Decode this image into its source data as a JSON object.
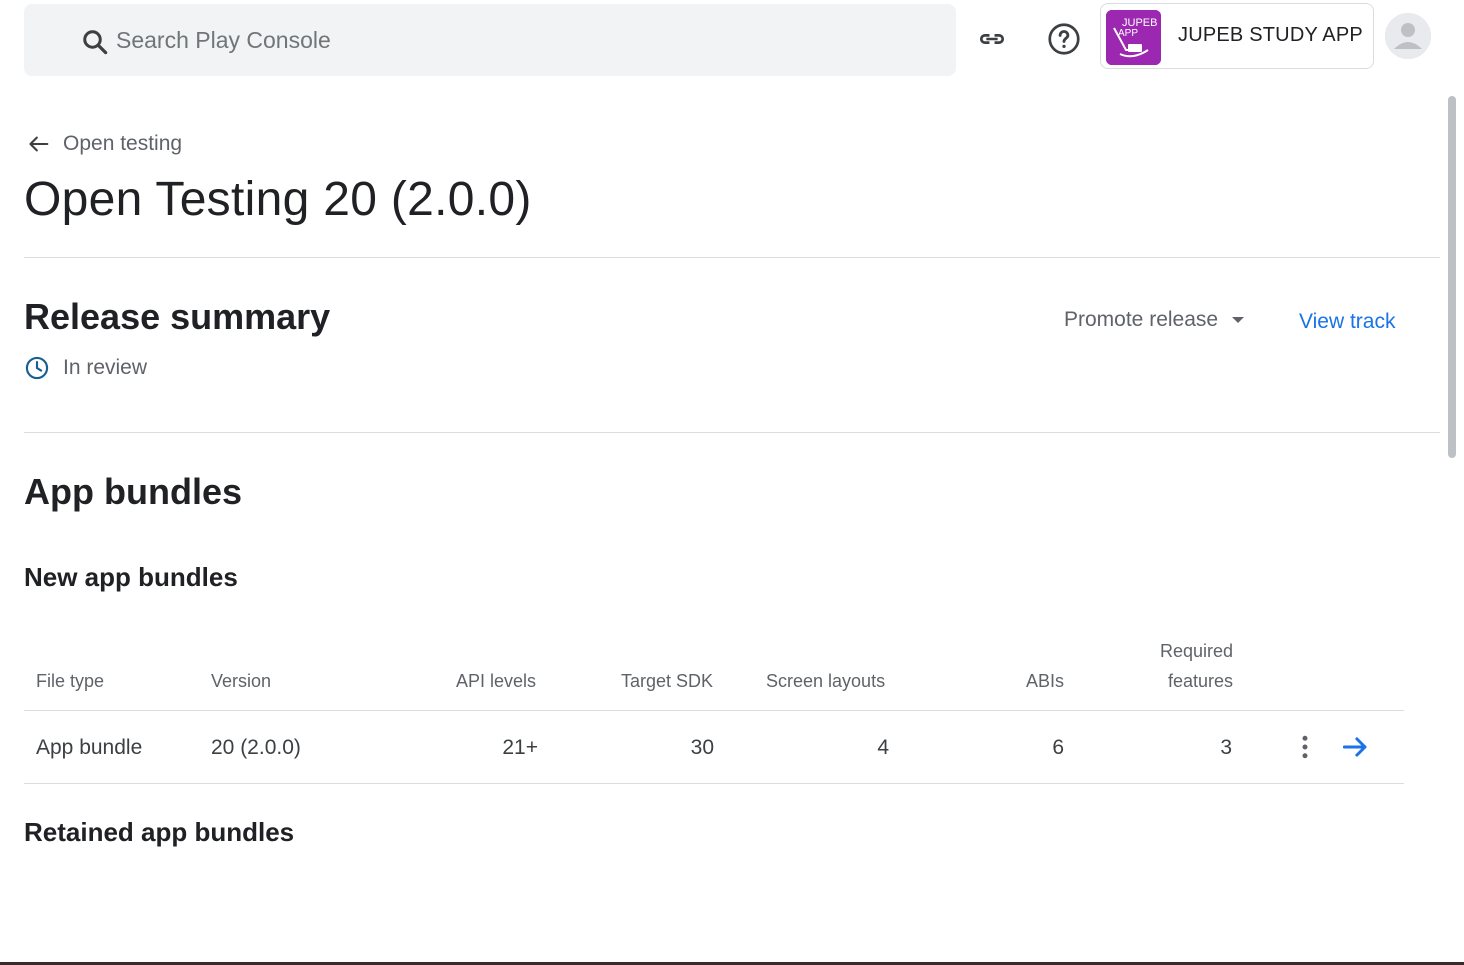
{
  "search": {
    "placeholder": "Search Play Console"
  },
  "app": {
    "name": "JUPEB STUDY APP",
    "logo_text": "JUPEB APP"
  },
  "breadcrumb": {
    "back_label": "Open testing"
  },
  "page": {
    "title": "Open Testing 20 (2.0.0)"
  },
  "release_summary": {
    "title": "Release summary",
    "status": "In review",
    "promote_label": "Promote release",
    "view_track_label": "View track"
  },
  "bundles": {
    "title": "App bundles",
    "new_title": "New app bundles",
    "retained_title": "Retained app bundles",
    "columns": {
      "file_type": "File type",
      "version": "Version",
      "api_levels": "API levels",
      "target_sdk": "Target SDK",
      "screen_layouts": "Screen layouts",
      "abis": "ABIs",
      "required_features_1": "Required",
      "required_features_2": "features"
    },
    "rows": [
      {
        "file_type": "App bundle",
        "version": "20 (2.0.0)",
        "api_levels": "21+",
        "target_sdk": "30",
        "screen_layouts": "4",
        "abis": "6",
        "required_features": "3"
      }
    ]
  },
  "icons": {
    "search": "search-icon",
    "link": "link-icon",
    "help": "help-icon",
    "back": "arrow-back-icon",
    "clock": "clock-icon",
    "caret": "caret-down-icon",
    "more": "more-vert-icon",
    "open": "arrow-forward-icon"
  },
  "colors": {
    "accent": "#1a73e8",
    "app_logo": "#9c27b0",
    "status_icon": "#1a5f8e"
  }
}
